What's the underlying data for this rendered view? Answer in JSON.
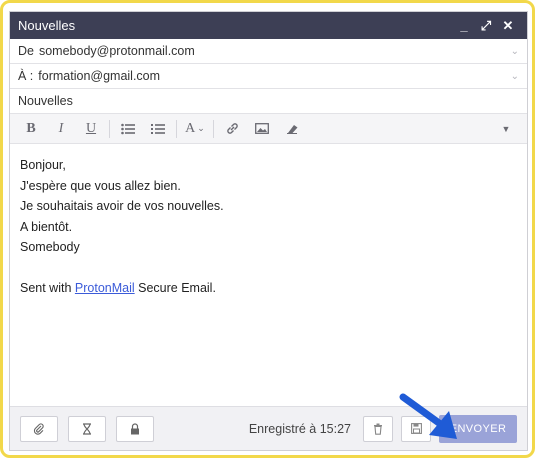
{
  "window": {
    "title": "Nouvelles",
    "controls": {
      "minimize": "_",
      "maximize": "⤢",
      "close": "✕"
    }
  },
  "from": {
    "label": "De",
    "value": "somebody@protonmail.com"
  },
  "to": {
    "label": "À :",
    "value": "formation@gmail.com"
  },
  "subject": {
    "value": "Nouvelles"
  },
  "toolbar": {
    "bold": "B",
    "italic": "I",
    "underline": "U",
    "font_size": "A"
  },
  "message": {
    "lines": [
      "Bonjour,",
      "J'espère que vous allez bien.",
      "Je souhaitais avoir de vos nouvelles.",
      "A bientôt.",
      "Somebody"
    ],
    "signature": {
      "prefix": "Sent with ",
      "link": "ProtonMail",
      "suffix": " Secure Email."
    }
  },
  "footer": {
    "saved_text": "Enregistré à 15:27",
    "send_label": "ENVOYER"
  },
  "colors": {
    "titlebar": "#3d3f55",
    "send_button": "#9aa3d8",
    "highlight_frame": "#f2d84a",
    "arrow": "#1f5bd6",
    "link": "#3b5bd9"
  }
}
